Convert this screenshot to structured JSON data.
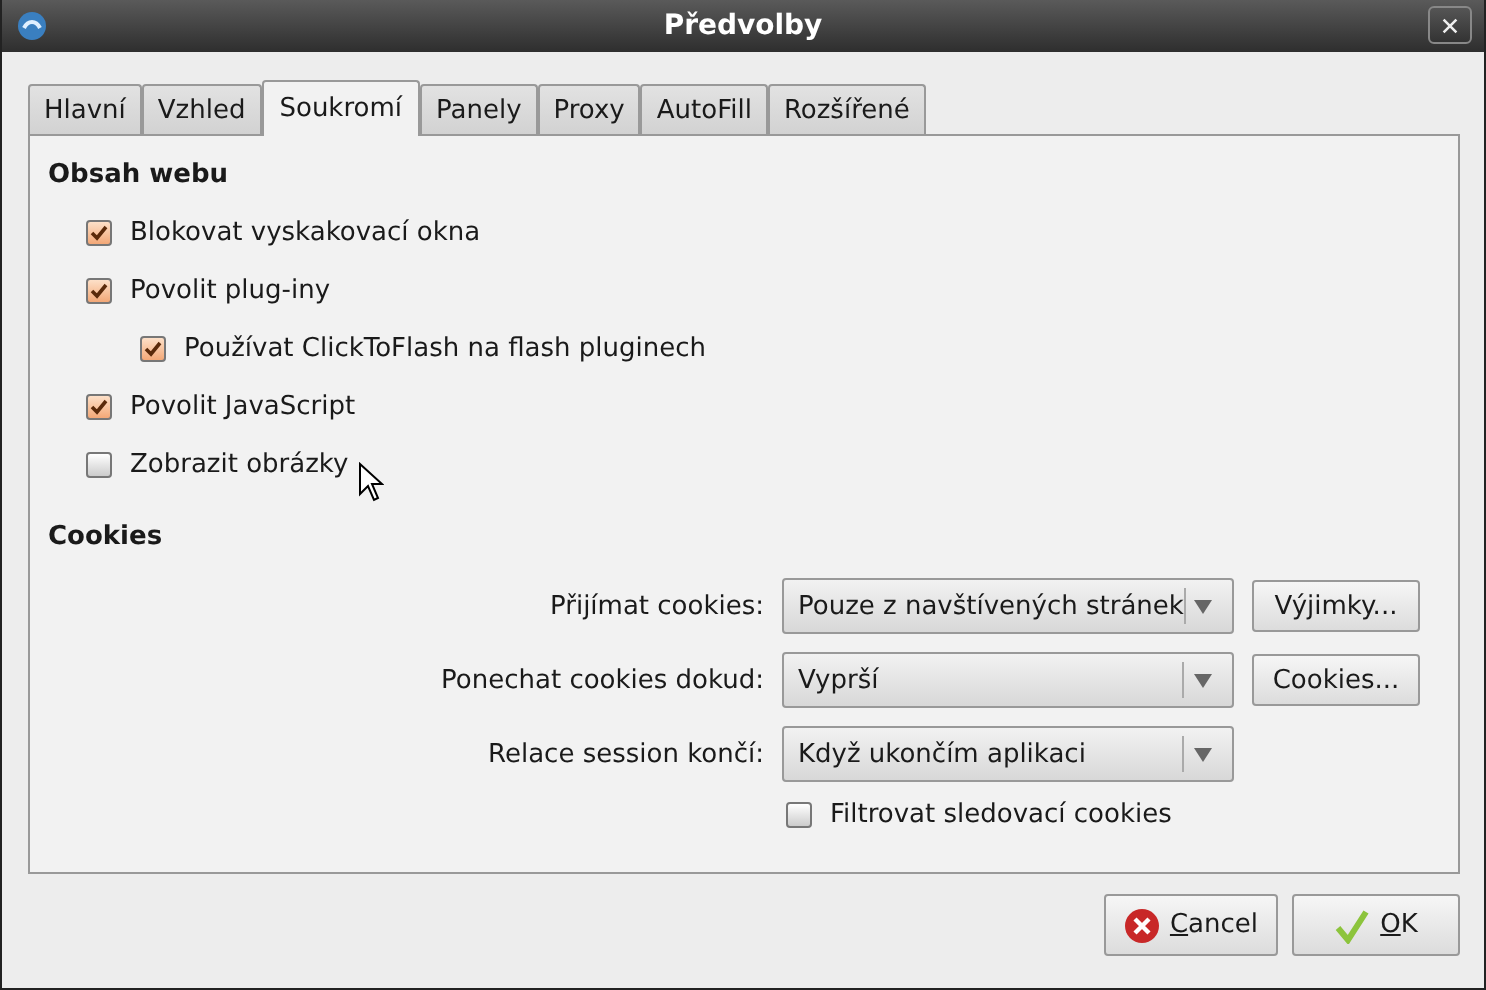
{
  "window": {
    "title": "Předvolby"
  },
  "tabs": [
    {
      "label": "Hlavní",
      "selected": false
    },
    {
      "label": "Vzhled",
      "selected": false
    },
    {
      "label": "Soukromí",
      "selected": true
    },
    {
      "label": "Panely",
      "selected": false
    },
    {
      "label": "Proxy",
      "selected": false
    },
    {
      "label": "AutoFill",
      "selected": false
    },
    {
      "label": "Rozšířené",
      "selected": false
    }
  ],
  "web_content": {
    "heading": "Obsah webu",
    "options": [
      {
        "label": "Blokovat vyskakovací okna",
        "checked": true
      },
      {
        "label": "Povolit plug-iny",
        "checked": true,
        "children": [
          {
            "label": "Používat ClickToFlash na flash pluginech",
            "checked": true
          }
        ]
      },
      {
        "label": "Povolit JavaScript",
        "checked": true
      },
      {
        "label": "Zobrazit obrázky",
        "checked": false
      }
    ]
  },
  "cookies": {
    "heading": "Cookies",
    "rows": [
      {
        "label": "Přijímat cookies:",
        "value": "Pouze z navštívených stránek",
        "button": "Výjimky..."
      },
      {
        "label": "Ponechat cookies dokud:",
        "value": "Vyprší",
        "button": "Cookies..."
      },
      {
        "label": "Relace session končí:",
        "value": "Když ukončím aplikaci"
      }
    ],
    "filter": {
      "label": "Filtrovat sledovací cookies",
      "checked": false
    }
  },
  "buttons": [
    {
      "label": "Cancel",
      "kind": "cancel"
    },
    {
      "label": "OK",
      "kind": "ok"
    }
  ]
}
